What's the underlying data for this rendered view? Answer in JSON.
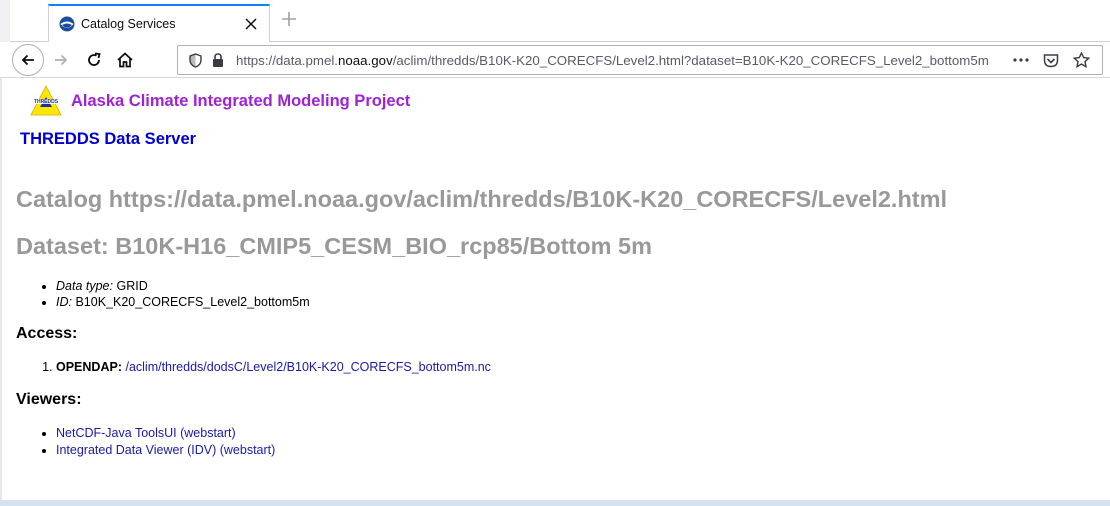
{
  "browser": {
    "tab_title": "Catalog Services",
    "url_prefix": "https://data.pmel.",
    "url_host": "noaa.gov",
    "url_suffix": "/aclim/thredds/B10K-K20_CORECFS/Level2.html?dataset=B10K-K20_CORECFS_Level2_bottom5m"
  },
  "page": {
    "logo_text": "THREDDS",
    "project_title": "Alaska Climate Integrated Modeling Project",
    "server_title": "THREDDS Data Server",
    "catalog_heading": "Catalog https://data.pmel.noaa.gov/aclim/thredds/B10K-K20_CORECFS/Level2.html",
    "dataset_heading": "Dataset: B10K-H16_CMIP5_CESM_BIO_rcp85/Bottom 5m",
    "properties": [
      {
        "label": "Data type:",
        "value": "GRID"
      },
      {
        "label": "ID:",
        "value": "B10K_K20_CORECFS_Level2_bottom5m"
      }
    ],
    "access_heading": "Access:",
    "access": [
      {
        "service": "OPENDAP:",
        "link": "/aclim/thredds/dodsC/Level2/B10K-K20_CORECFS_bottom5m.nc"
      }
    ],
    "viewers_heading": "Viewers:",
    "viewers": [
      "NetCDF-Java ToolsUI (webstart)",
      "Integrated Data Viewer (IDV) (webstart)"
    ]
  },
  "colors": {
    "project_title": "#9f22d3",
    "server_title": "#0000cc",
    "heading_gray": "#999999",
    "link": "#1a1aa6"
  }
}
